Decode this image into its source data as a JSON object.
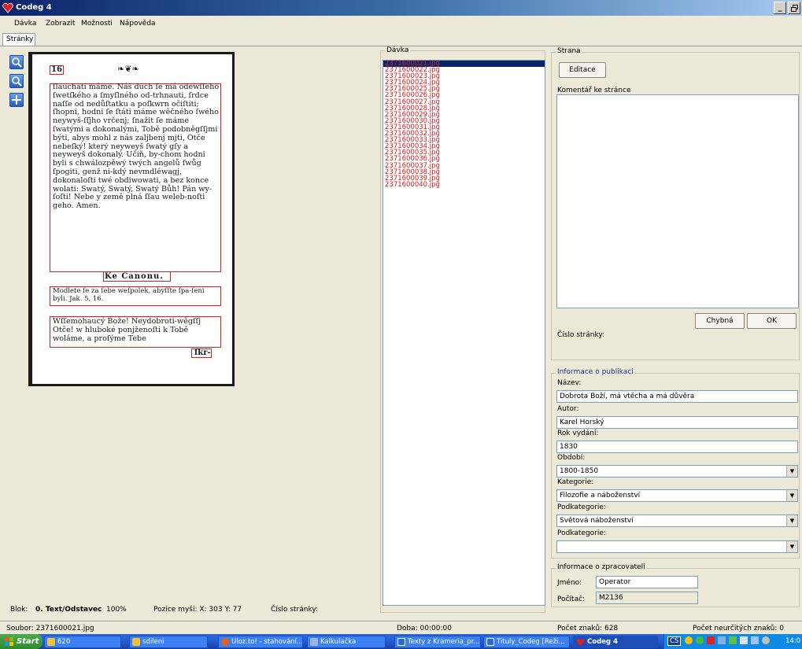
{
  "window": {
    "title": "Codeg 4",
    "buttons": [
      "_",
      "\b",
      "×"
    ]
  },
  "menu": [
    "Dávka",
    "Zobrazit",
    "Možnosti",
    "Nápověda"
  ],
  "tab": "Stránky",
  "page_image": {
    "page_number": "16",
    "paragraph1": "ſlauchati máme. Náš duch ſe má odewſſeho ſwetſkého a ſmyſlného od-trhnauti, ſrdce naſſe od nedůſtatku a poſkwrn očiſtiti; ſhopni, hodni ſe ſtáti máme wěčného ſwého neywyš-ſſjho vrčenj; ſnažit ſe máme ſwatými a dokonalými, Tobě podobněgſſjmi býti, abys mohl z nás zaljbenj mjti, Otče nebeſký! který neyweyš ſwatý gſy a neyweyš dokonalý. Učiň, by-chom hodni byli s chwálozpěwý twých angelů ſwůg ſpogiti, genž ni-kdý nevmdléwagj, dokonaloſti twé obdiwowati, a bez konce wolati: Swatý, Swatý, Swatý Bůh! Pán wy-ſoſti! Nebe y země plná ſſau weleb-noſti geho. Amen.",
    "heading": "Ke Canonu.",
    "paragraph2": "Modlete ſe za ſebe weſpolek, abyſſte ſpa-ſeni byli. Jak. 5, 16.",
    "paragraph3": "Wſſemohaucý Bože! Neydobroti-wěgſſj Otče! w hluboké ponjženoſti k Tobě woláme, a proſýme Tebe",
    "catchword": "ſkr-"
  },
  "batch": {
    "label": "Dávka",
    "items": [
      "2371600021.jpg",
      "2371600022.jpg",
      "2371600023.jpg",
      "2371600024.jpg",
      "2371600025.jpg",
      "2371600026.jpg",
      "2371600027.jpg",
      "2371600028.jpg",
      "2371600029.jpg",
      "2371600030.jpg",
      "2371600031.jpg",
      "2371600032.jpg",
      "2371600033.jpg",
      "2371600034.jpg",
      "2371600035.jpg",
      "2371600036.jpg",
      "2371600037.jpg",
      "2371600038.jpg",
      "2371600039.jpg",
      "2371600040.jpg"
    ]
  },
  "page_panel": {
    "label": "Strana",
    "edit_button": "Editace",
    "comment_label": "Komentář ke stránce",
    "comment_value": "",
    "bad_button": "Chybná",
    "ok_button": "OK",
    "page_number_label": "Číslo stránky:"
  },
  "publication": {
    "label": "Informace o publikaci",
    "name_label": "Název:",
    "name_value": "Dobrota Boží, má vtěcha a má důvěra",
    "author_label": "Autor:",
    "author_value": "Karel Horský",
    "year_label": "Rok vydání:",
    "year_value": "1830",
    "period_label": "Období:",
    "period_value": "1800-1850",
    "category_label": "Kategorie:",
    "category_value": "Filozofie a náboženství",
    "subcategory_label": "Podkategorie:",
    "subcategory_value": "Světová náboženství",
    "subcategory2_label": "Podkategorie:",
    "subcategory2_value": ""
  },
  "processor": {
    "label": "Informace o zpracovateli",
    "name_label": "Jméno:",
    "name_value": "Operator",
    "computer_label": "Počítač:",
    "computer_value": "M2136"
  },
  "viewer_status": {
    "block_label": "Blok:",
    "block_value": "0. Text/Odstavec",
    "zoom": "100%",
    "mouse_pos": "Pozice myši: X: 303 Y: 77",
    "page_number": "Číslo stránky:"
  },
  "statusbar": {
    "file": "Soubor: 2371600021.jpg",
    "duration": "Doba: 00:00:00",
    "chars": "Počet znaků: 628",
    "uncertain": "Počet neurčitých znaků: 0"
  },
  "taskbar": {
    "start": "Start",
    "tasks": [
      {
        "label": "620",
        "color": "#f0c040"
      },
      {
        "label": "sdileni",
        "color": "#f0c040"
      },
      {
        "label": "Uloz.to! - stahování...",
        "color": "#e06020"
      },
      {
        "label": "Kalkulačka",
        "color": "#9ab4e0"
      },
      {
        "label": "Texty z Krameria_pr...",
        "color": "#2a6bd8"
      },
      {
        "label": "Tituly_Codeg [Reži...",
        "color": "#2a6bd8"
      },
      {
        "label": "Codeg 4",
        "color": "#d22020"
      }
    ],
    "tray_lang": "CS",
    "clock": "14:0"
  }
}
